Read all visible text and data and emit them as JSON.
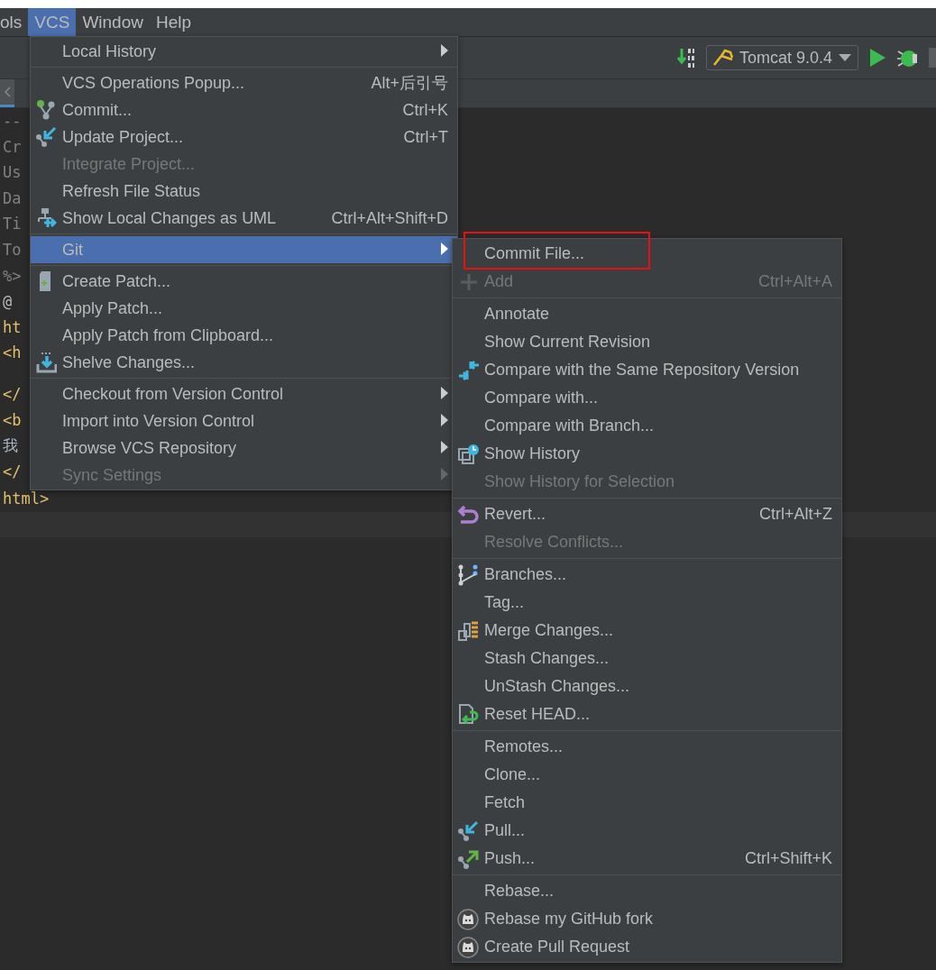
{
  "menubar": [
    {
      "label": "ols",
      "selected": false
    },
    {
      "label": "VCS",
      "selected": true
    },
    {
      "label": "Window",
      "selected": false
    },
    {
      "label": "Help",
      "selected": false
    }
  ],
  "toolbar": {
    "run_config": "Tomcat 9.0.4"
  },
  "editor": {
    "lines": [
      {
        "text": "--",
        "kind": "comment"
      },
      {
        "text": "Cr",
        "kind": "comment"
      },
      {
        "text": "Us",
        "kind": "comment"
      },
      {
        "text": "Da",
        "kind": "comment"
      },
      {
        "text": "Ti",
        "kind": "comment"
      },
      {
        "text": "To",
        "kind": "comment"
      },
      {
        "text": "%>",
        "kind": "comment"
      },
      {
        "text": "@",
        "kind": "directive"
      },
      {
        "text": "ht",
        "kind": "tag"
      },
      {
        "text": "<h",
        "kind": "tag"
      },
      {
        "kind": "blank"
      },
      {
        "text": "</",
        "kind": "tag"
      },
      {
        "text": "<b",
        "kind": "tag"
      },
      {
        "text": "我",
        "kind": "plain"
      },
      {
        "text": "</",
        "kind": "tag"
      },
      {
        "text": "html>",
        "kind": "tag"
      }
    ]
  },
  "vcs_menu": {
    "groups": [
      [
        {
          "label": "Local History",
          "submenu": true,
          "disabled": false,
          "selected": false
        }
      ],
      [
        {
          "label": "VCS Operations Popup...",
          "shortcut": "Alt+后引号",
          "submenu": false,
          "disabled": false,
          "selected": false
        },
        {
          "label": "Commit...",
          "shortcut": "Ctrl+K",
          "kind": "commit",
          "submenu": false,
          "disabled": false,
          "selected": false
        },
        {
          "label": "Update Project...",
          "shortcut": "Ctrl+T",
          "kind": "pull",
          "submenu": false,
          "disabled": false,
          "selected": false
        },
        {
          "label": "Integrate Project...",
          "submenu": false,
          "disabled": true,
          "selected": false
        },
        {
          "label": "Refresh File Status",
          "submenu": false,
          "disabled": false,
          "selected": false
        },
        {
          "label": "Show Local Changes as UML",
          "shortcut": "Ctrl+Alt+Shift+D",
          "kind": "uml",
          "submenu": false,
          "disabled": false,
          "selected": false
        }
      ],
      [
        {
          "label": "Git",
          "submenu": true,
          "disabled": false,
          "selected": true
        }
      ],
      [
        {
          "label": "Create Patch...",
          "kind": "patch",
          "submenu": false,
          "disabled": false,
          "selected": false
        },
        {
          "label": "Apply Patch...",
          "submenu": false,
          "disabled": false,
          "selected": false
        },
        {
          "label": "Apply Patch from Clipboard...",
          "submenu": false,
          "disabled": false,
          "selected": false
        },
        {
          "label": "Shelve Changes...",
          "kind": "shelve",
          "submenu": false,
          "disabled": false,
          "selected": false
        }
      ],
      [
        {
          "label": "Checkout from Version Control",
          "submenu": true,
          "disabled": false,
          "selected": false
        },
        {
          "label": "Import into Version Control",
          "submenu": true,
          "disabled": false,
          "selected": false
        },
        {
          "label": "Browse VCS Repository",
          "submenu": true,
          "disabled": false,
          "selected": false
        },
        {
          "label": "Sync Settings",
          "submenu": true,
          "disabled": true,
          "selected": false
        }
      ]
    ]
  },
  "git_menu": {
    "groups": [
      [
        {
          "label": "Commit File...",
          "highlighted": true,
          "disabled": false,
          "selected": false
        },
        {
          "label": "Add",
          "shortcut": "Ctrl+Alt+A",
          "kind": "plus",
          "disabled": true,
          "selected": false
        }
      ],
      [
        {
          "label": "Annotate",
          "disabled": false,
          "selected": false
        },
        {
          "label": "Show Current Revision",
          "disabled": false,
          "selected": false
        },
        {
          "label": "Compare with the Same Repository Version",
          "kind": "compare",
          "disabled": false,
          "selected": false
        },
        {
          "label": "Compare with...",
          "disabled": false,
          "selected": false
        },
        {
          "label": "Compare with Branch...",
          "disabled": false,
          "selected": false
        },
        {
          "label": "Show History",
          "kind": "history",
          "disabled": false,
          "selected": false
        },
        {
          "label": "Show History for Selection",
          "disabled": true,
          "selected": false
        }
      ],
      [
        {
          "label": "Revert...",
          "shortcut": "Ctrl+Alt+Z",
          "kind": "revert",
          "disabled": false,
          "selected": false
        },
        {
          "label": "Resolve Conflicts...",
          "disabled": true,
          "selected": false
        }
      ],
      [
        {
          "label": "Branches...",
          "kind": "branches",
          "disabled": false,
          "selected": false
        },
        {
          "label": "Tag...",
          "disabled": false,
          "selected": false
        },
        {
          "label": "Merge Changes...",
          "kind": "merge",
          "disabled": false,
          "selected": false
        },
        {
          "label": "Stash Changes...",
          "disabled": false,
          "selected": false
        },
        {
          "label": "UnStash Changes...",
          "disabled": false,
          "selected": false
        },
        {
          "label": "Reset HEAD...",
          "kind": "reset",
          "disabled": false,
          "selected": false
        }
      ],
      [
        {
          "label": "Remotes...",
          "disabled": false,
          "selected": false
        },
        {
          "label": "Clone...",
          "disabled": false,
          "selected": false
        },
        {
          "label": "Fetch",
          "disabled": false,
          "selected": false
        },
        {
          "label": "Pull...",
          "kind": "pull",
          "disabled": false,
          "selected": false
        },
        {
          "label": "Push...",
          "shortcut": "Ctrl+Shift+K",
          "kind": "push",
          "disabled": false,
          "selected": false
        }
      ],
      [
        {
          "label": "Rebase...",
          "disabled": false,
          "selected": false
        },
        {
          "label": "Rebase my GitHub fork",
          "kind": "github",
          "disabled": false,
          "selected": false
        },
        {
          "label": "Create Pull Request",
          "kind": "github",
          "disabled": false,
          "selected": false
        }
      ]
    ]
  }
}
